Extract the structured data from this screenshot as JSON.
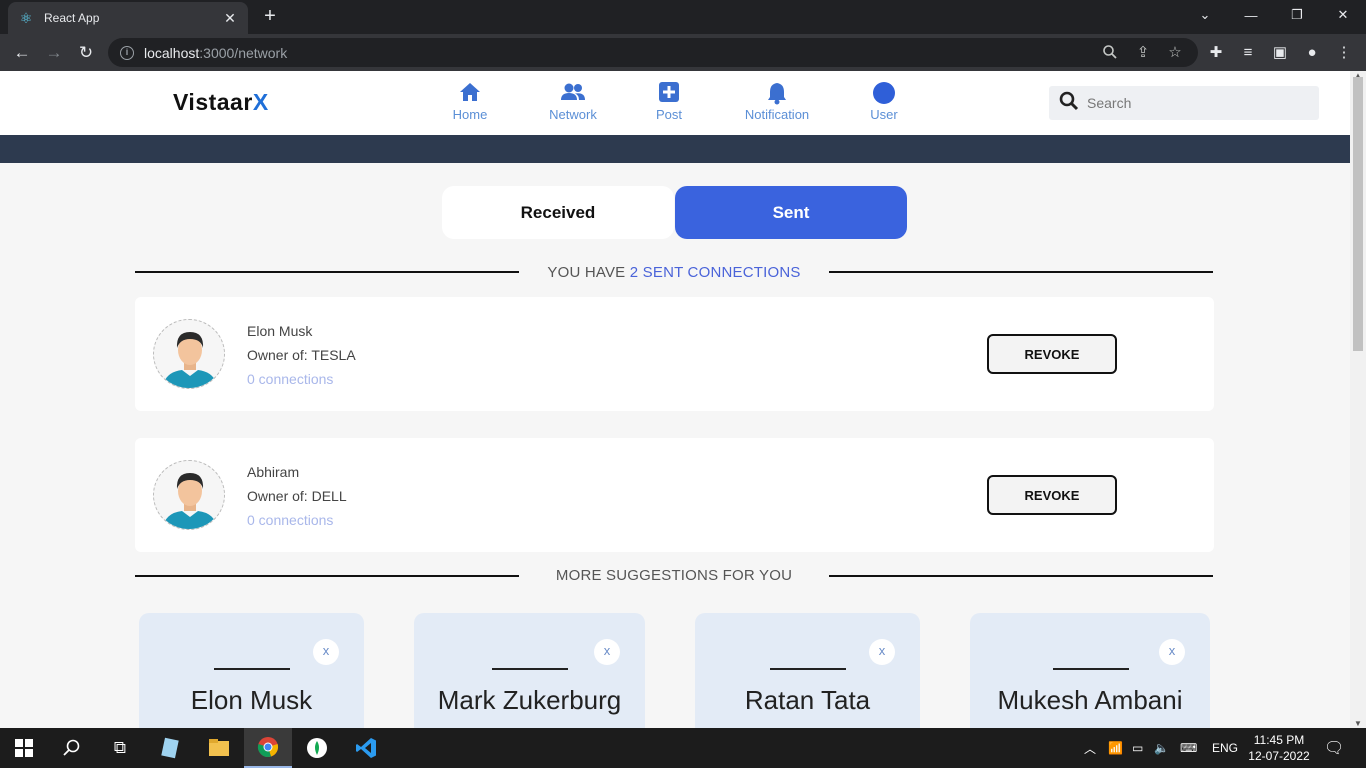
{
  "browser": {
    "tab_title": "React App",
    "url_host": "localhost",
    "url_rest": ":3000/network",
    "new_tab": "+",
    "close_tab": "✕"
  },
  "app": {
    "logo_main": "Vistaar",
    "logo_accent": "X",
    "nav": [
      {
        "label": "Home",
        "icon": "home-icon"
      },
      {
        "label": "Network",
        "icon": "network-icon"
      },
      {
        "label": "Post",
        "icon": "post-icon"
      },
      {
        "label": "Notification",
        "icon": "bell-icon"
      },
      {
        "label": "User",
        "icon": "user-icon"
      }
    ],
    "search_placeholder": "Search",
    "accent_color": "#3a63de",
    "header_band_color": "#2d3a4f"
  },
  "toggle": {
    "received": "Received",
    "sent": "Sent",
    "active": "Sent"
  },
  "sent_section": {
    "prefix": "YOU HAVE ",
    "highlight": "2 SENT CONNECTIONS"
  },
  "connections": [
    {
      "name": "Elon Musk",
      "owner": "Owner of: TESLA",
      "connections": "0 connections",
      "action": "REVOKE"
    },
    {
      "name": "Abhiram",
      "owner": "Owner of: DELL",
      "connections": "0 connections",
      "action": "REVOKE"
    }
  ],
  "suggestions_title": "MORE SUGGESTIONS FOR YOU",
  "suggestions": [
    {
      "name": "Elon Musk",
      "close": "x"
    },
    {
      "name": "Mark Zukerburg",
      "close": "x"
    },
    {
      "name": "Ratan Tata",
      "close": "x"
    },
    {
      "name": "Mukesh Ambani",
      "close": "x"
    }
  ],
  "taskbar": {
    "lang": "ENG",
    "time": "11:45 PM",
    "date": "12-07-2022"
  }
}
